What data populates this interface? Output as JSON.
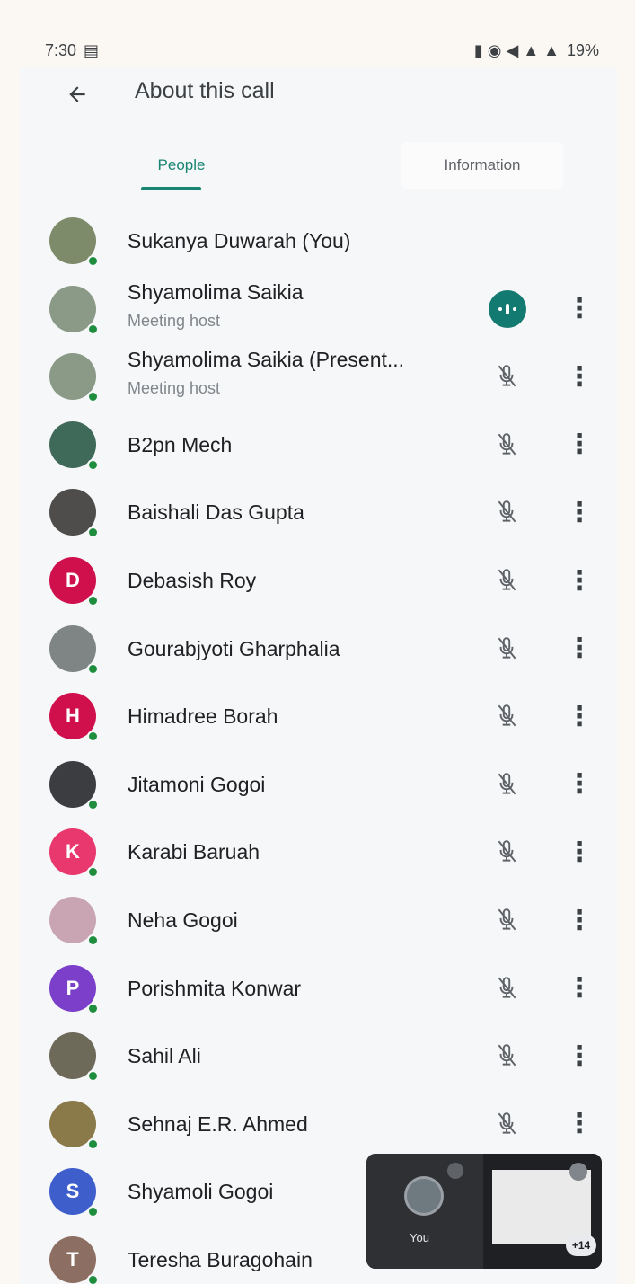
{
  "status_bar": {
    "time": "7:30",
    "right_text": "19%"
  },
  "header": {
    "title": "About this call"
  },
  "tabs": [
    {
      "label": "People",
      "active": true
    },
    {
      "label": "Information",
      "active": false
    }
  ],
  "people": [
    {
      "name": "Sukanya Duwarah (You)",
      "subtitle": "",
      "avatar_color": "#7d8b6a",
      "initial": "",
      "status": "none"
    },
    {
      "name": "Shyamolima Saikia",
      "subtitle": "Meeting host",
      "avatar_color": "#8a9a86",
      "initial": "",
      "status": "speaking"
    },
    {
      "name": "Shyamolima Saikia (Present...",
      "subtitle": "Meeting host",
      "avatar_color": "#8a9a86",
      "initial": "",
      "status": "muted"
    },
    {
      "name": "B2pn Mech",
      "subtitle": "",
      "avatar_color": "#3f6a5a",
      "initial": "",
      "status": "muted"
    },
    {
      "name": "Baishali Das Gupta",
      "subtitle": "",
      "avatar_color": "#4e4d4c",
      "initial": "",
      "status": "muted"
    },
    {
      "name": "Debasish Roy",
      "subtitle": "",
      "avatar_color": "#d0104c",
      "initial": "D",
      "status": "muted"
    },
    {
      "name": "Gourabjyoti Gharphalia",
      "subtitle": "",
      "avatar_color": "#7f8585",
      "initial": "",
      "status": "muted"
    },
    {
      "name": "Himadree Borah",
      "subtitle": "",
      "avatar_color": "#d0104c",
      "initial": "H",
      "status": "muted"
    },
    {
      "name": "Jitamoni Gogoi",
      "subtitle": "",
      "avatar_color": "#3b3d40",
      "initial": "",
      "status": "muted"
    },
    {
      "name": "Karabi Baruah",
      "subtitle": "",
      "avatar_color": "#e8386d",
      "initial": "K",
      "status": "muted"
    },
    {
      "name": "Neha Gogoi",
      "subtitle": "",
      "avatar_color": "#c9a4b3",
      "initial": "",
      "status": "muted"
    },
    {
      "name": "Porishmita Konwar",
      "subtitle": "",
      "avatar_color": "#7b3fc9",
      "initial": "P",
      "status": "muted"
    },
    {
      "name": "Sahil Ali",
      "subtitle": "",
      "avatar_color": "#6d6a5a",
      "initial": "",
      "status": "muted"
    },
    {
      "name": "Sehnaj E.R. Ahmed",
      "subtitle": "",
      "avatar_color": "#8a7a4a",
      "initial": "",
      "status": "muted"
    },
    {
      "name": "Shyamoli Gogoi",
      "subtitle": "",
      "avatar_color": "#3e5fcb",
      "initial": "S",
      "status": "none"
    },
    {
      "name": "Teresha Buragohain",
      "subtitle": "",
      "avatar_color": "#8d6e63",
      "initial": "T",
      "status": "none"
    }
  ],
  "pip": {
    "self_label": "You",
    "count_badge": "+14"
  },
  "colors": {
    "accent": "#188572",
    "online_dot": "#1e8e3e",
    "speaking_bg": "#137a72"
  }
}
